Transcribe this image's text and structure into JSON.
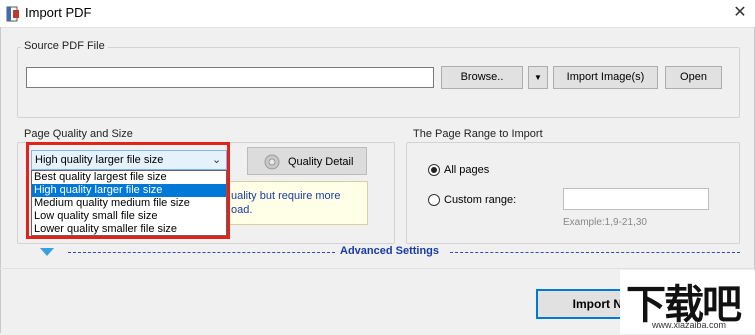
{
  "window": {
    "title": "Import PDF",
    "close_glyph": "✕"
  },
  "source": {
    "group_label": "Source PDF File",
    "path_value": "",
    "browse_label": "Browse..",
    "menu_glyph": "▼",
    "import_images_label": "Import Image(s)",
    "open_label": "Open"
  },
  "quality": {
    "group_label": "Page Quality and Size",
    "selected": "High quality larger file size",
    "chevron": "⌄",
    "options": [
      "Best quality largest file size",
      "High quality larger file size",
      "Medium quality medium file size",
      "Low quality small file size",
      "Lower quality smaller file size"
    ],
    "selected_index": 1,
    "detail_label": "Quality Detail",
    "info_line1": "uality but require more",
    "info_line2": "oad."
  },
  "page_range": {
    "group_label": "The Page Range to Import",
    "all_pages_label": "All pages",
    "custom_label": "Custom range:",
    "custom_value": "",
    "example": "Example:1,9-21,30",
    "selected": "all"
  },
  "advanced": {
    "label": "Advanced Settings"
  },
  "footer": {
    "import_label": "Import No"
  },
  "watermark": {
    "big": "下载吧",
    "url": "www.xiazaiba.com"
  },
  "colors": {
    "highlight": "#e2231a",
    "selection": "#0078d7",
    "advanced": "#1a3aa8"
  }
}
